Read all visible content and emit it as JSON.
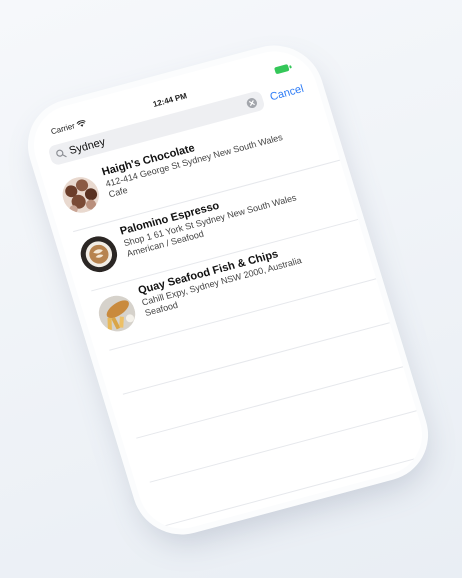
{
  "status_bar": {
    "carrier": "Carrier",
    "time": "12:44 PM",
    "battery_color": "#34c759"
  },
  "search": {
    "query": "Sydney",
    "cancel_label": "Cancel"
  },
  "results": [
    {
      "name": "Haigh's Chocolate",
      "address": "412-414 George St Sydney New South Wales",
      "category": "Cafe",
      "thumbnail_icon": "chocolates-photo"
    },
    {
      "name": "Palomino Espresso",
      "address": "Shop 1 61 York St Sydney New South Wales",
      "category": "American / Seafood",
      "thumbnail_icon": "coffee-cup-photo"
    },
    {
      "name": "Quay Seafood Fish & Chips",
      "address": "Cahill Expy, Sydney NSW 2000, Australia",
      "category": "Seafood",
      "thumbnail_icon": "fish-and-chips-photo"
    }
  ],
  "accent_color": "#2f7df6"
}
